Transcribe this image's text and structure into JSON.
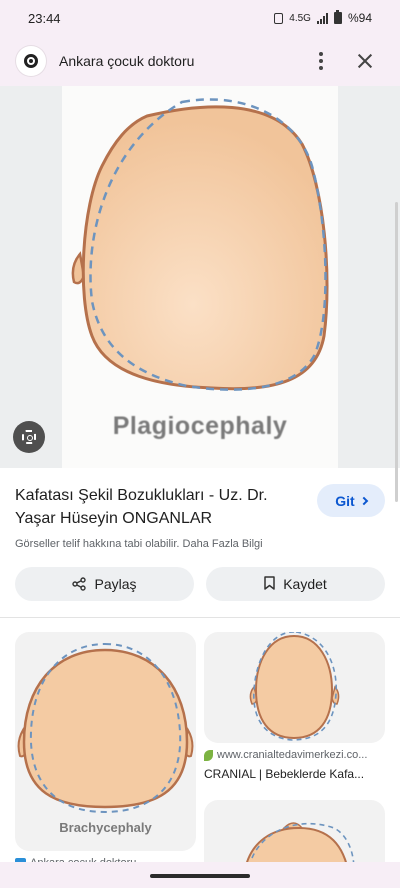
{
  "status_bar": {
    "time": "23:44",
    "network": "4.5G",
    "battery": "%94"
  },
  "header": {
    "title": "Ankara çocuk doktoru"
  },
  "hero": {
    "image_caption": "Plagiocephaly"
  },
  "result": {
    "title": "Kafatası Şekil Bozuklukları - Uz. Dr. Yaşar Hüseyin ONGANLAR",
    "go_label": "Git",
    "copyright": "Görseller telif hakkına tabi olabilir. Daha Fazla Bilgi",
    "share_label": "Paylaş",
    "save_label": "Kaydet"
  },
  "related": {
    "items": [
      {
        "image_caption": "Brachycephaly",
        "source": "Ankara çocuk doktoru"
      },
      {
        "source": "www.cranialtedavimerkezi.co...",
        "title": "CRANIAL | Bebeklerde Kafa..."
      }
    ]
  },
  "colors": {
    "skin": "#f4cba3",
    "outline": "#b5714c",
    "dashed": "#6d94bf",
    "accent": "#0b57d0",
    "chrome": "#f7eef6"
  }
}
